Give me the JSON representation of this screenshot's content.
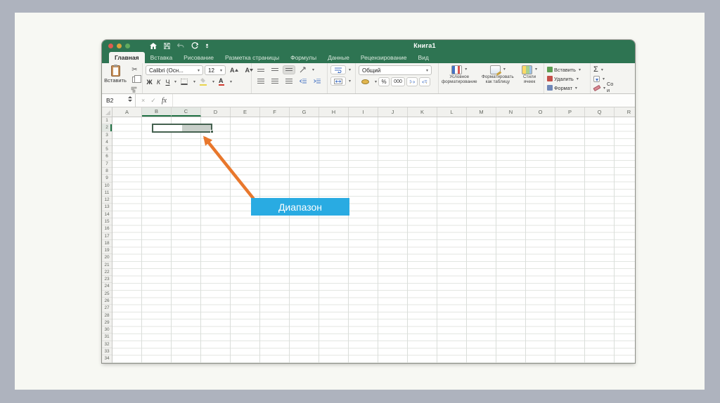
{
  "window": {
    "title": "Книга1",
    "titlebar_color": "#2e7452"
  },
  "tabs": [
    {
      "id": "glavnaya",
      "label": "Главная",
      "active": true
    },
    {
      "id": "vstavka",
      "label": "Вставка",
      "active": false
    },
    {
      "id": "risovanie",
      "label": "Рисование",
      "active": false
    },
    {
      "id": "razmetka-stranicy",
      "label": "Разметка страницы",
      "active": false
    },
    {
      "id": "formuly",
      "label": "Формулы",
      "active": false
    },
    {
      "id": "dannye",
      "label": "Данные",
      "active": false
    },
    {
      "id": "recenzirovanie",
      "label": "Рецензирование",
      "active": false
    },
    {
      "id": "vid",
      "label": "Вид",
      "active": false
    }
  ],
  "ribbon": {
    "paste_label": "Вставить",
    "font_name": "Calibri (Осн...",
    "font_size": "12",
    "grow_font": "A",
    "shrink_font": "A",
    "bold": "Ж",
    "italic": "К",
    "underline": "Ч",
    "font_color_letter": "A",
    "number_format": "Общий",
    "percent": "%",
    "thousands": "000",
    "conditional_formatting": "Условное форматирование",
    "format_as_table": "Форматировать как таблицу",
    "cell_styles": "Стили ячеек",
    "insert_label": "Вставить",
    "delete_label": "Удалить",
    "format_label": "Формат",
    "autosum": "Σ",
    "sort_cut_line1": "Со",
    "sort_cut_line2": "и",
    "dropdown_glyph": "▾"
  },
  "formula_bar": {
    "name_box": "B2",
    "cancel": "×",
    "enter": "✓",
    "fx": "fx",
    "formula_value": ""
  },
  "sheet": {
    "columns": [
      "A",
      "B",
      "C",
      "D",
      "E",
      "F",
      "G",
      "H",
      "I",
      "J",
      "K",
      "L",
      "M",
      "N",
      "O",
      "P",
      "Q",
      "R"
    ],
    "row_count": 34,
    "selection": {
      "range": "B2:C2",
      "active_cell": "B2",
      "highlight_columns": [
        "B",
        "C"
      ],
      "highlight_row": 2
    }
  },
  "callout": {
    "label": "Диапазон",
    "bg_color": "#29abe2",
    "arrow_color": "#e8772c"
  }
}
